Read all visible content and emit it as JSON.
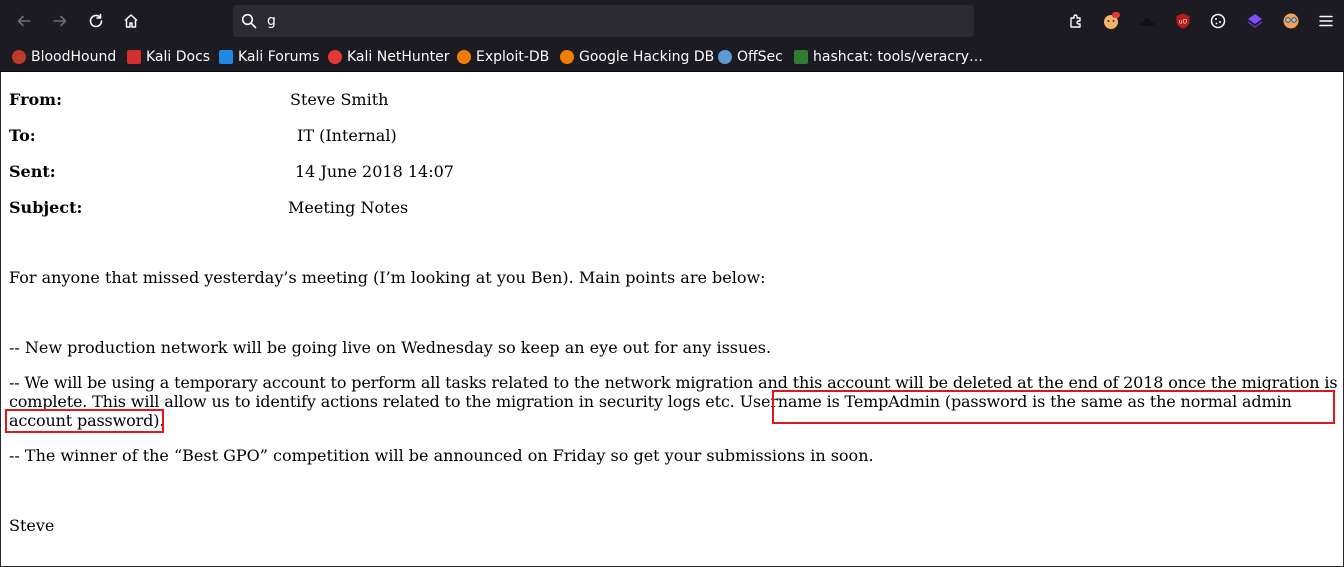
{
  "browser": {
    "url_value": "g",
    "icons": {
      "back": "arrow-left-icon",
      "forward": "arrow-right-icon",
      "reload": "reload-icon",
      "home": "home-icon",
      "search": "search-icon",
      "extensions": "puzzle-icon",
      "menu": "hamburger-menu-icon"
    }
  },
  "bookmarks": [
    {
      "label": "BloodHound",
      "color": "#c0392b"
    },
    {
      "label": "Kali Docs",
      "color": "#d32f2f"
    },
    {
      "label": "Kali Forums",
      "color": "#1e88e5"
    },
    {
      "label": "Kali NetHunter",
      "color": "#e53935"
    },
    {
      "label": "Exploit-DB",
      "color": "#f57c00"
    },
    {
      "label": "Google Hacking DB",
      "color": "#f57c00"
    },
    {
      "label": "OffSec",
      "color": "#5c9bd6"
    },
    {
      "label": "hashcat: tools/veracry…",
      "color": "#2e7d32"
    }
  ],
  "email": {
    "from_label": "From:",
    "from_value": "Steve Smith",
    "to_label": "To:",
    "to_value": "IT (Internal)",
    "sent_label": "Sent:",
    "sent_value": "14 June 2018 14:07",
    "subject_label": "Subject:",
    "subject_value": "Meeting Notes",
    "intro": "For anyone that missed yesterday’s meeting (I’m looking at you Ben). Main points are below:",
    "point1": "-- New production network will be going live on Wednesday so keep an eye out for any issues.",
    "point2_a": "-- We will be using a temporary account to perform all tasks related to the network migration and this account will be deleted at the end of 2018 once the migration is complete. This will allow us to identify actions related to the migration in security logs etc. ",
    "point2_highlight": "Username is TempAdmin (password is the same as the normal admin account password)",
    "point2_end": ".",
    "point3": "-- The winner of the “Best GPO” competition will be announced on Friday so get your submissions in soon.",
    "signature": "Steve"
  },
  "colors": {
    "chrome_bg": "#1c1b22",
    "urlbar_bg": "#2b2a33",
    "highlight_box": "#e0161d"
  }
}
